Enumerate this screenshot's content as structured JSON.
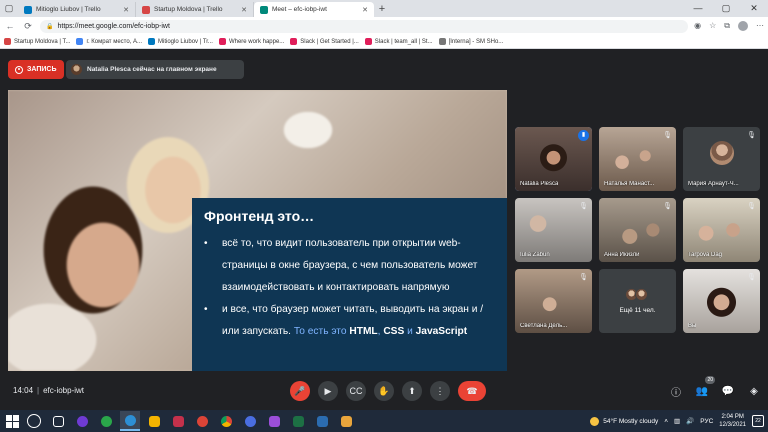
{
  "browser": {
    "tabs": [
      {
        "title": "Mitioglo Liubov | Trello",
        "color": "#0079bf"
      },
      {
        "title": "Startup Moldova | Trello",
        "color": "#d64545"
      },
      {
        "title": "Meet – efc-iobp-iwt",
        "color": "#00897b"
      }
    ],
    "new_tab": "+",
    "url": "https://meet.google.com/efc-iobp-iwt",
    "bookmarks": [
      {
        "label": "Startup Moldova | T...",
        "color": "#d64545"
      },
      {
        "label": "г. Комрат место, А...",
        "color": "#4285f4"
      },
      {
        "label": "Mitioglo Liubov | Tr...",
        "color": "#0079bf"
      },
      {
        "label": "Where work happe...",
        "color": "#e01e5a"
      },
      {
        "label": "Slack | Get Started |...",
        "color": "#e01e5a"
      },
      {
        "label": "Slack | team_all | St...",
        "color": "#e01e5a"
      },
      {
        "label": "[Interna] - SM SHo...",
        "color": "#777777"
      }
    ]
  },
  "meet": {
    "record_label": "ЗАПИСЬ",
    "presenter_text": "Natalia Plesca сейчас на главном экране",
    "slide": {
      "title": "Фронтенд это…",
      "bullet1": "всё то, что видит пользователь при открытии web-страницы в окне браузера, с чем пользователь может взаимодействовать и контактировать напрямую",
      "bullet2_pre": "и все, что браузер может читать, выводить на экран и / или запускать. ",
      "bullet2_hl": "То есть это ",
      "html": "HTML",
      "comma": ", ",
      "css": "CSS",
      "and": " и ",
      "js": "JavaScript"
    },
    "participants": [
      "Natalia Plesca",
      "Наталья Манаст...",
      "Мария Арнаут-Ч...",
      "Iulia Zabun",
      "Анна Икизли",
      "Tarpova Dag",
      "Светлана Дель...",
      "Ещё 11 чел.",
      "Вы"
    ],
    "time": "14:04",
    "meeting_code": "efc-iobp-iwt",
    "people_count": "20"
  },
  "taskbar": {
    "weather": "54°F  Mostly cloudy",
    "lang": "РУС",
    "time": "2:04 PM",
    "date": "12/3/2021",
    "notifications": "22"
  }
}
